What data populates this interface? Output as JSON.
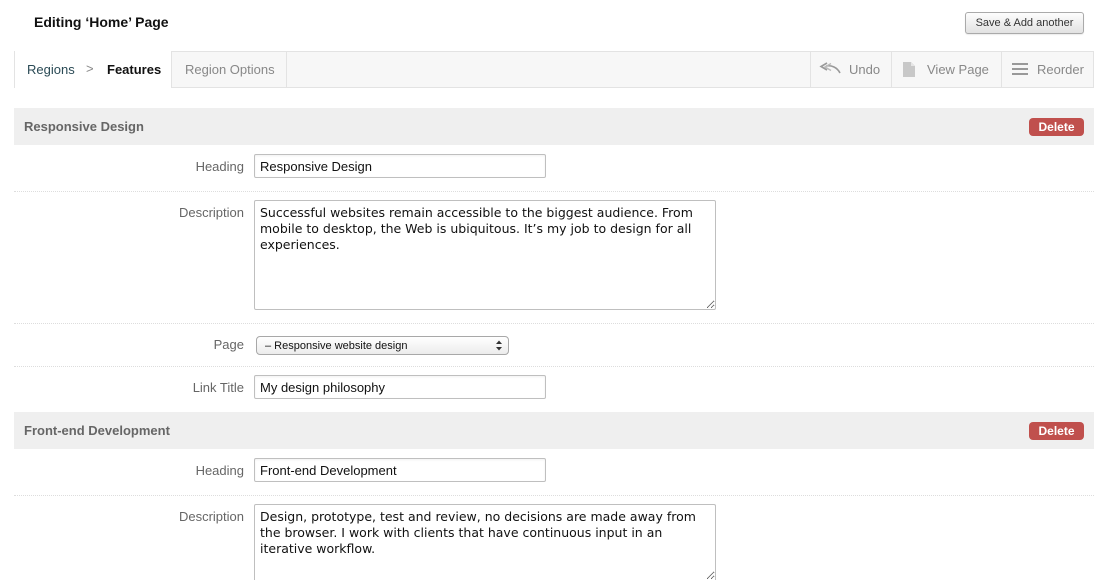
{
  "header": {
    "title": "Editing ‘Home’ Page",
    "save_add_label": "Save & Add another"
  },
  "toolbar": {
    "breadcrumb": {
      "regions": "Regions",
      "separator": ">",
      "features": "Features"
    },
    "region_options": "Region Options",
    "undo": "Undo",
    "view_page": "View Page",
    "reorder": "Reorder",
    "icons": [
      "undo-icon",
      "page-icon",
      "reorder-icon"
    ]
  },
  "sections": [
    {
      "title": "Responsive Design",
      "delete_label": "Delete",
      "fields": {
        "heading_label": "Heading",
        "heading_value": "Responsive Design",
        "description_label": "Description",
        "description_value": "Successful websites remain accessible to the biggest audience. From mobile to desktop, the Web is ubiquitous. It’s my job to design for all experiences.",
        "page_label": "Page",
        "page_value": "– Responsive website design",
        "link_title_label": "Link Title",
        "link_title_value": "My design philosophy"
      }
    },
    {
      "title": "Front-end Development",
      "delete_label": "Delete",
      "fields": {
        "heading_label": "Heading",
        "heading_value": "Front-end Development",
        "description_label": "Description",
        "description_value": "Design, prototype, test and review, no decisions are made away from the browser. I work with clients that have continuous input in an iterative workflow."
      }
    }
  ],
  "colors": {
    "delete": "#c0504d",
    "section_header": "#efefef",
    "breadcrumb_link": "#2a4a55"
  }
}
